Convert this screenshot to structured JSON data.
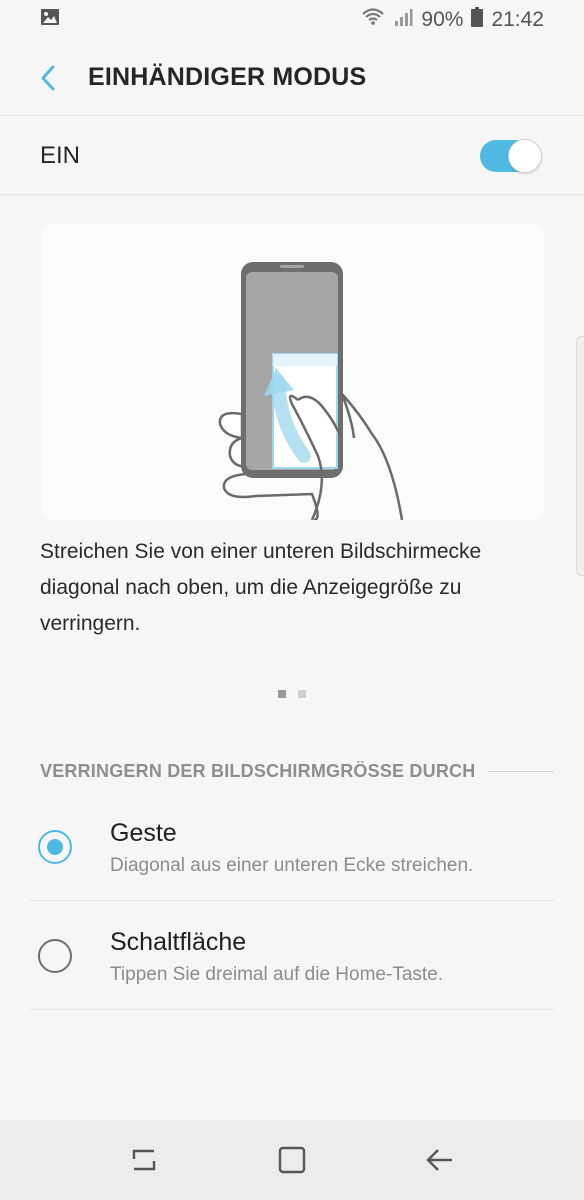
{
  "status_bar": {
    "battery": "90%",
    "time": "21:42"
  },
  "header": {
    "title": "EINHÄNDIGER MODUS"
  },
  "master_toggle": {
    "label": "EIN",
    "on": true,
    "accent_color": "#4fb9e3"
  },
  "tutorial": {
    "description": "Streichen Sie von einer unteren Bildschirmecke diagonal nach oben, um die Anzeigegröße zu verringern.",
    "page_index": 1,
    "page_count": 2
  },
  "section": {
    "title": "VERRINGERN DER BILDSCHIRMGRÖSSE DURCH"
  },
  "options": [
    {
      "title": "Geste",
      "subtitle": "Diagonal aus einer unteren Ecke streichen.",
      "selected": true
    },
    {
      "title": "Schaltfläche",
      "subtitle": "Tippen Sie dreimal auf die Home-Taste.",
      "selected": false
    }
  ],
  "navigation": {
    "buttons": [
      "recents-icon",
      "home-icon",
      "back-icon"
    ]
  }
}
